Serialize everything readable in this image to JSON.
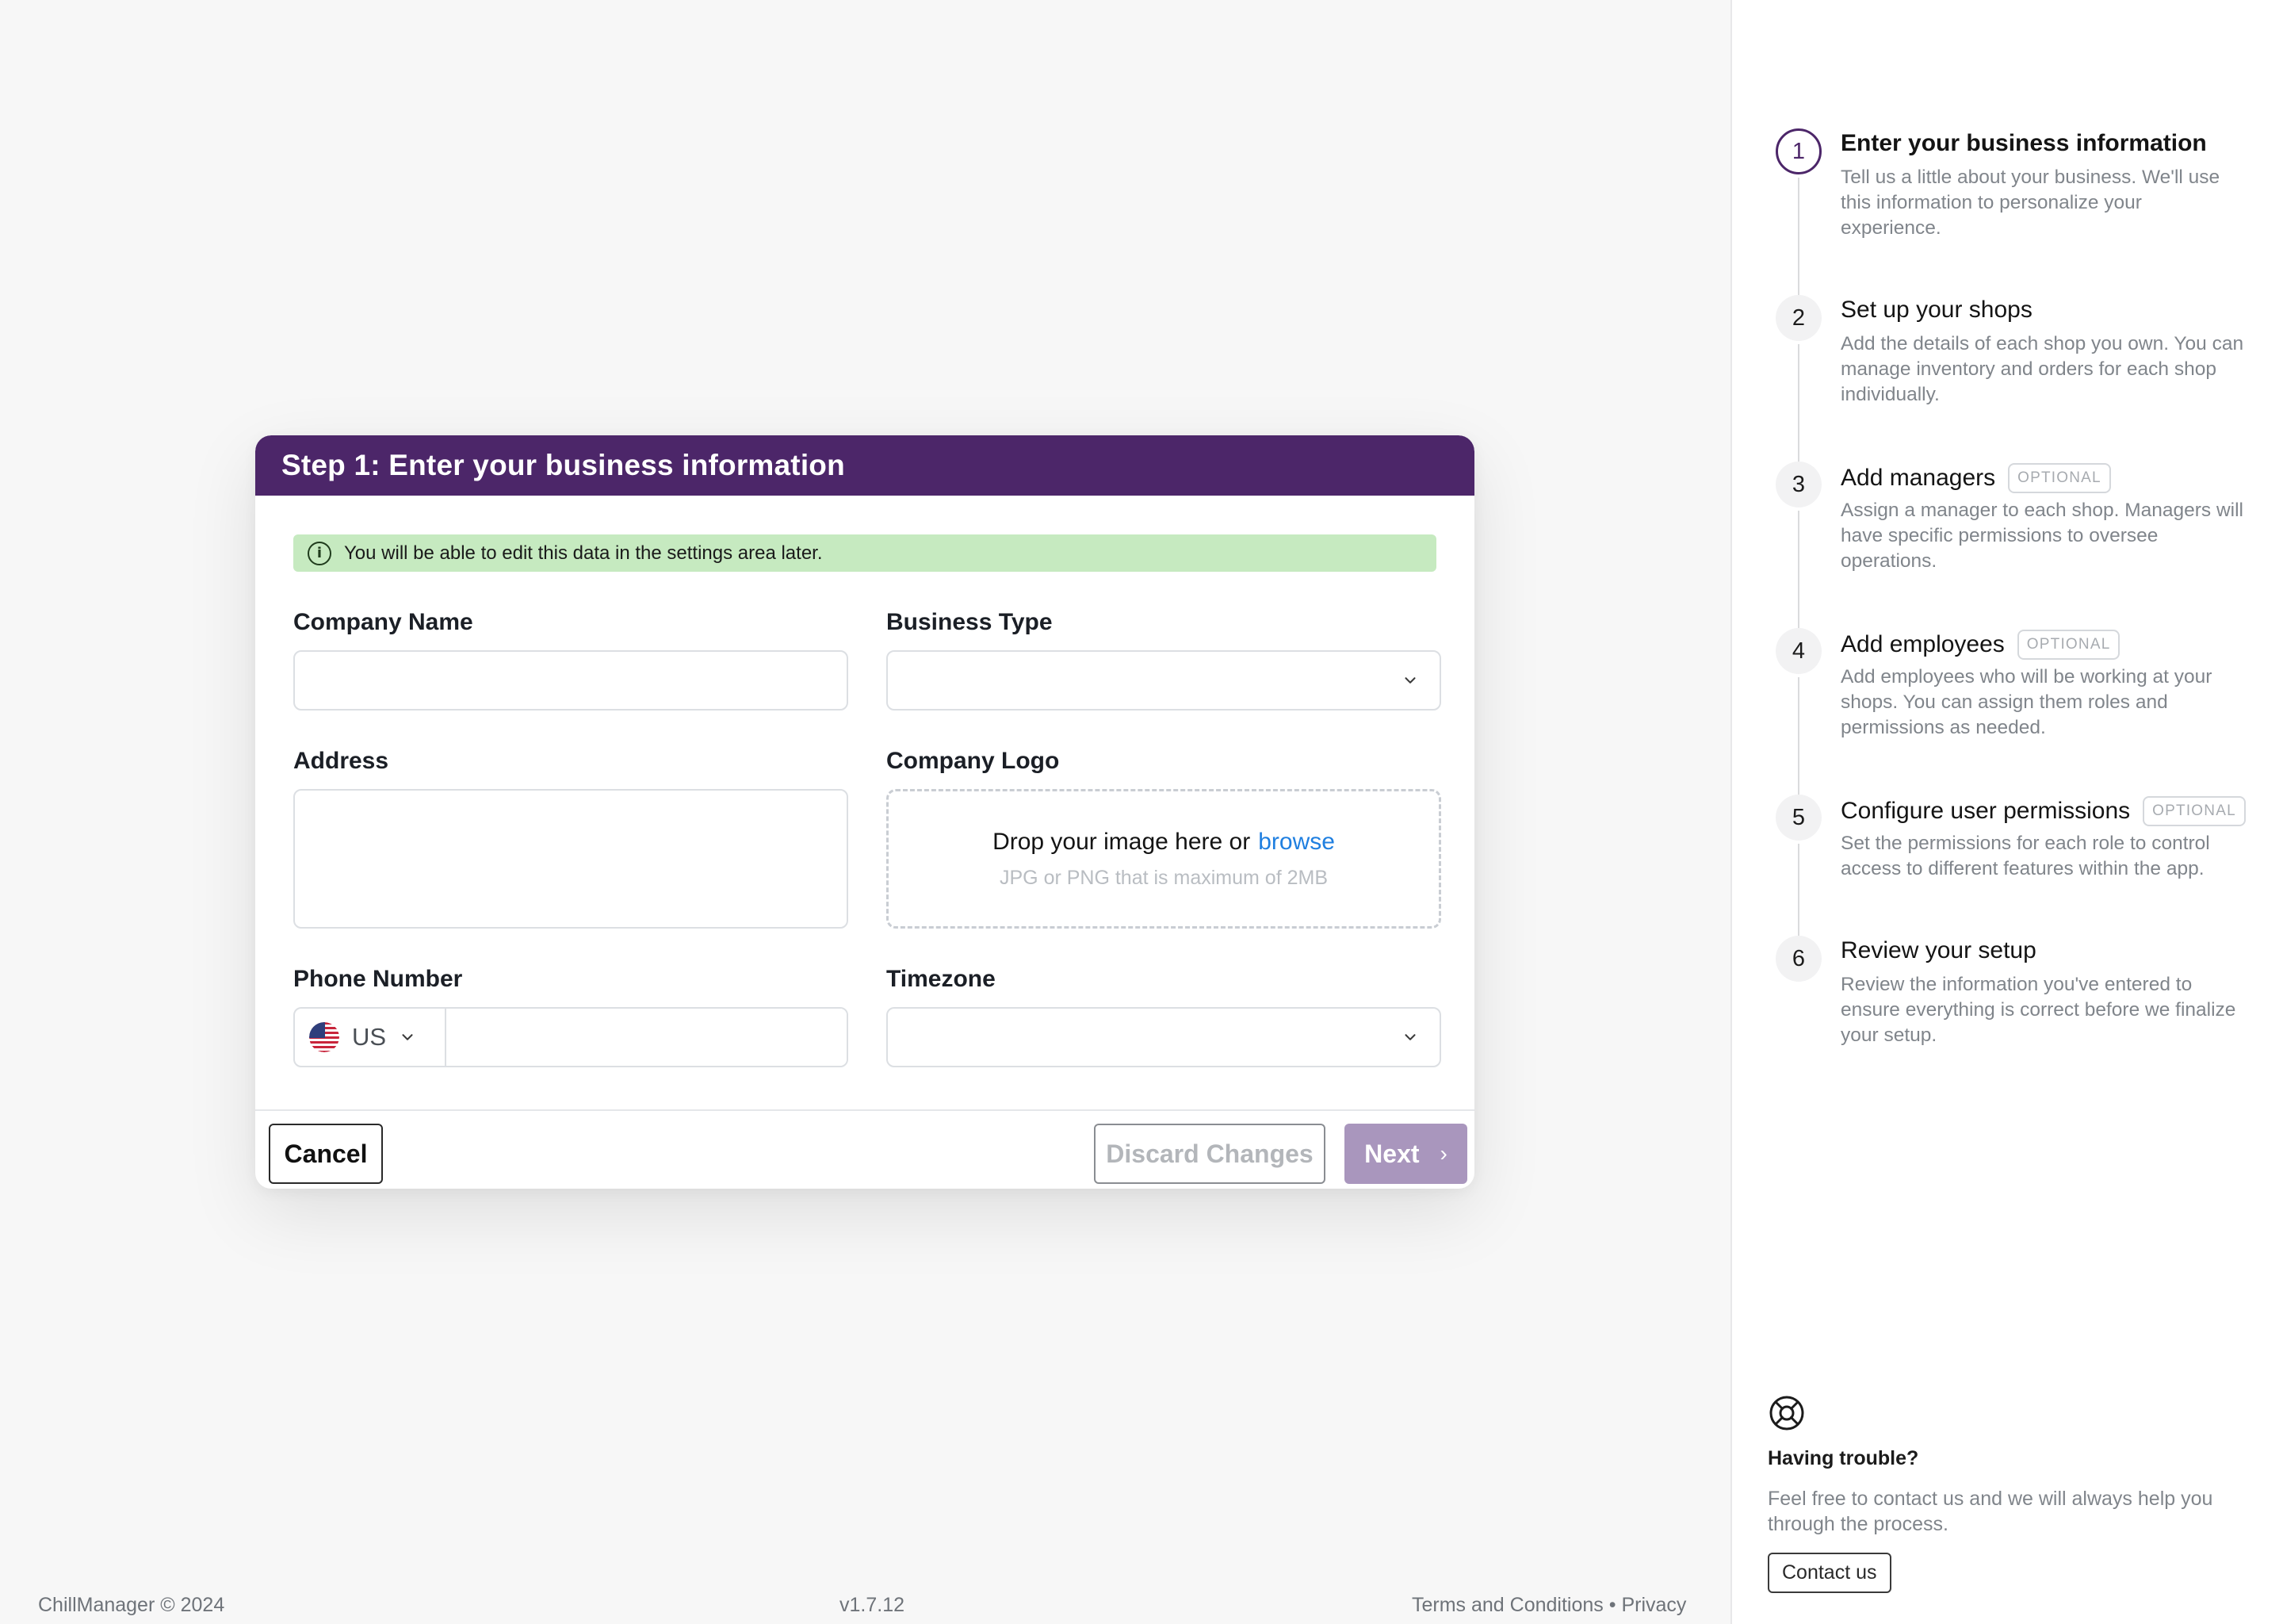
{
  "card": {
    "title": "Step 1: Enter your business information",
    "info_banner": "You will be able to edit this data in the settings area later.",
    "fields": {
      "company_name_label": "Company Name",
      "business_type_label": "Business Type",
      "address_label": "Address",
      "company_logo_label": "Company Logo",
      "phone_number_label": "Phone Number",
      "timezone_label": "Timezone"
    },
    "logo_drop": {
      "text": "Drop your image here or",
      "link": "browse",
      "hint": "JPG or PNG that is maximum of 2MB"
    },
    "phone": {
      "country_code": "US",
      "flag_icon": "us-flag-icon"
    },
    "buttons": {
      "cancel": "Cancel",
      "discard": "Discard Changes",
      "next": "Next"
    }
  },
  "footer": {
    "copyright": "ChillManager © 2024",
    "version": "v1.7.12",
    "terms": "Terms and Conditions",
    "separator": "•",
    "privacy": "Privacy"
  },
  "sidebar": {
    "optional_label": "OPTIONAL",
    "steps": [
      {
        "number": "1",
        "title": "Enter your business information",
        "description": "Tell us a little about your business. We'll use this information to personalize your experience.",
        "active": true,
        "optional": false
      },
      {
        "number": "2",
        "title": "Set up your shops",
        "description": "Add the details of each shop you own. You can manage inventory and orders for each shop individually.",
        "active": false,
        "optional": false
      },
      {
        "number": "3",
        "title": "Add managers",
        "description": "Assign a manager to each shop. Managers will have specific permissions to oversee operations.",
        "active": false,
        "optional": true
      },
      {
        "number": "4",
        "title": "Add employees",
        "description": "Add employees who will be working at your shops. You can assign them roles and permissions as needed.",
        "active": false,
        "optional": true
      },
      {
        "number": "5",
        "title": "Configure user permissions",
        "description": "Set the permissions for each role to control access to different features within the app.",
        "active": false,
        "optional": true
      },
      {
        "number": "6",
        "title": "Review your setup",
        "description": "Review the information you've entered to ensure everything is correct before we finalize your setup.",
        "active": false,
        "optional": false
      }
    ],
    "help": {
      "icon": "lifebuoy-icon",
      "title": "Having trouble?",
      "text": "Feel free to contact us and we will always help you through the process.",
      "button": "Contact us"
    }
  },
  "colors": {
    "brand": "#4c2669",
    "banner_bg": "#c6eac0",
    "link": "#1f7fe0",
    "next_button": "#a996bd"
  }
}
